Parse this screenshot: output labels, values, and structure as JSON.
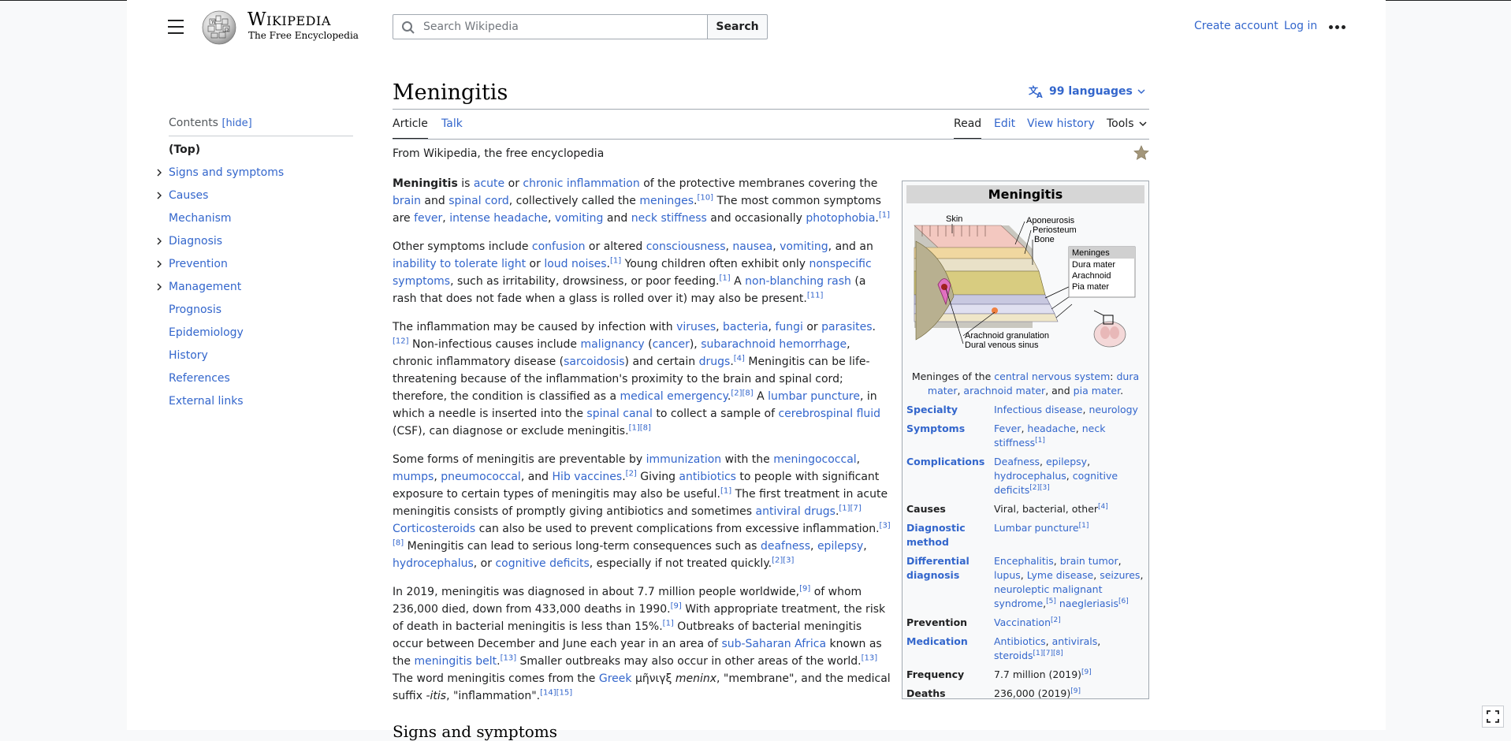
{
  "header": {
    "wordmark": "Wikipedia",
    "tagline": "The Free Encyclopedia",
    "search_placeholder": "Search Wikipedia",
    "search_button": "Search",
    "create_account": "Create account",
    "log_in": "Log in"
  },
  "toc": {
    "heading": "Contents",
    "hide_label": "[hide]",
    "items": [
      {
        "label": "(Top)"
      },
      {
        "label": "Signs and symptoms"
      },
      {
        "label": "Causes"
      },
      {
        "label": "Mechanism"
      },
      {
        "label": "Diagnosis"
      },
      {
        "label": "Prevention"
      },
      {
        "label": "Management"
      },
      {
        "label": "Prognosis"
      },
      {
        "label": "Epidemiology"
      },
      {
        "label": "History"
      },
      {
        "label": "References"
      },
      {
        "label": "External links"
      }
    ]
  },
  "article": {
    "title": "Meningitis",
    "languages": "99 languages",
    "tab_article": "Article",
    "tab_talk": "Talk",
    "tab_read": "Read",
    "tab_edit": "Edit",
    "tab_history": "View history",
    "tab_tools": "Tools",
    "from": "From Wikipedia, the free encyclopedia",
    "next_heading": "Signs and symptoms"
  },
  "infobox": {
    "title": "Meningitis",
    "diagram_labels": {
      "skin": "Skin",
      "aponeurosis": "Aponeurosis",
      "periosteum": "Periosteum",
      "bone": "Bone",
      "meninges": "Meninges",
      "dura": "Dura mater",
      "arachnoid": "Arachnoid",
      "pia": "Pia mater",
      "granulation": "Arachnoid granulation",
      "sinus": "Dural venous sinus"
    },
    "caption_pre": "Meninges of the",
    "caption_cns": "central nervous system",
    "caption_colon": ":",
    "caption_dura": "dura mater",
    "caption_arach": "arachnoid mater",
    "caption_and": ", and",
    "caption_pia": "pia mater",
    "rows": {
      "specialty_label": "Specialty",
      "specialty_1": "Infectious disease",
      "specialty_2": "neurology",
      "symptoms_label": "Symptoms",
      "symptoms_1": "Fever",
      "symptoms_2": "headache",
      "symptoms_3": "neck stiffness",
      "complications_label": "Complications",
      "complications_1": "Deafness",
      "complications_2": "epilepsy",
      "complications_3": "hydrocephalus",
      "complications_4": "cognitive deficits",
      "causes_label": "Causes",
      "causes_val": "Viral, bacterial, other",
      "diag_label": "Diagnostic method",
      "diag_val": "Lumbar puncture",
      "diff_label": "Differential diagnosis",
      "diff_1": "Encephalitis",
      "diff_2": "brain tumor",
      "diff_3": "lupus",
      "diff_4": "Lyme disease",
      "diff_5": "seizures",
      "diff_6": "neuroleptic malignant syndrome",
      "diff_7": "naegleriasis",
      "prevention_label": "Prevention",
      "prevention_val": "Vaccination",
      "medication_label": "Medication",
      "medication_1": "Antibiotics",
      "medication_2": "antivirals",
      "medication_3": "steroids",
      "frequency_label": "Frequency",
      "frequency_val": "7.7 million (2019)",
      "deaths_label": "Deaths",
      "deaths_val": "236,000 (2019)"
    }
  },
  "colors": {
    "link": "#3366cc",
    "text": "#202122",
    "border": "#a2a9b1"
  }
}
